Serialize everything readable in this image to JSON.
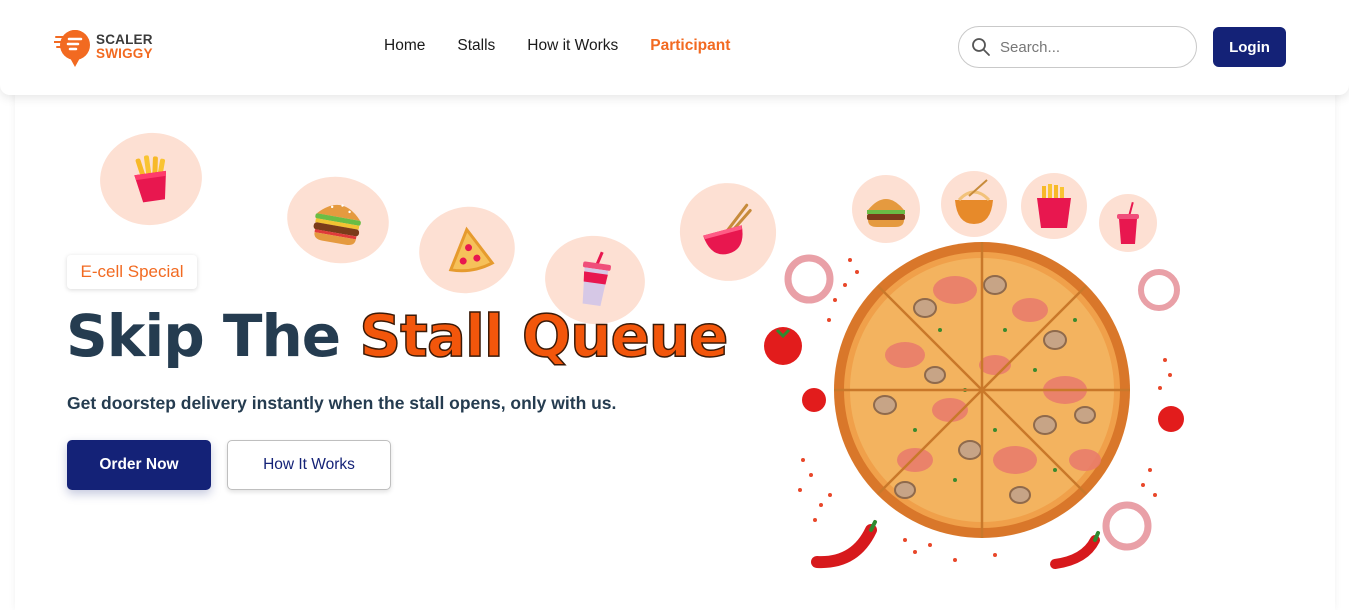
{
  "brand": {
    "line1": "SCALER",
    "line2": "SWIGGY",
    "accent": "#f26a21",
    "navy": "#142277"
  },
  "nav": {
    "items": [
      {
        "label": "Home",
        "active": false
      },
      {
        "label": "Stalls",
        "active": false
      },
      {
        "label": "How it Works",
        "active": false
      },
      {
        "label": "Participant",
        "active": true
      }
    ]
  },
  "search": {
    "placeholder": "Search...",
    "value": ""
  },
  "login": {
    "label": "Login"
  },
  "hero": {
    "badge": "E-cell Special",
    "headline_dark": "Skip The ",
    "headline_accent": "Stall Queue",
    "subtext": "Get doorstep delivery instantly when the stall opens, only with us.",
    "primary_button": "Order Now",
    "secondary_button": "How It Works"
  },
  "icons": [
    "fries-icon",
    "burger-icon",
    "pizza-slice-icon",
    "soda-cup-icon",
    "noodle-bowl-icon",
    "search-icon",
    "logo-icon"
  ]
}
